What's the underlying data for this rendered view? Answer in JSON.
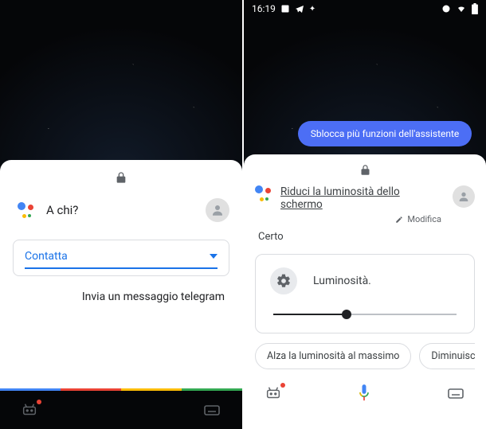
{
  "left": {
    "prompt": "A chi?",
    "select_label": "Contatta",
    "sub_action": "Invia un messaggio telegram"
  },
  "right": {
    "status_time": "16:19",
    "pill": "Sblocca più funzioni dell'assistente",
    "query": "Riduci la luminosità dello schermo",
    "edit_label": "Modifica",
    "reply": "Certo",
    "card_title": "Luminosità.",
    "chips": {
      "a": "Alza la luminosità al massimo",
      "b": "Diminuisci luminosità s"
    }
  }
}
